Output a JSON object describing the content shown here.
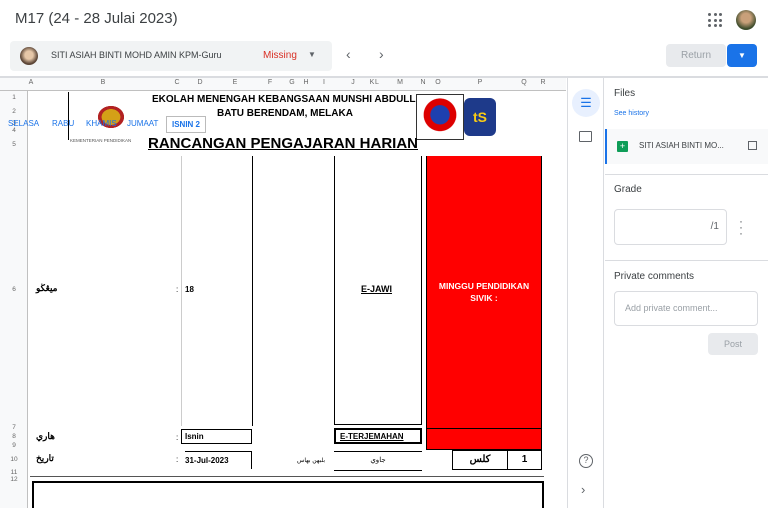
{
  "header": {
    "title": "M17 (24 - 28 Julai 2023)",
    "apps_icon": "apps-grid-icon"
  },
  "student_bar": {
    "name": "SITI ASIAH BINTI MOHD AMIN KPM-Guru",
    "status": "Missing",
    "status_color": "#d93025"
  },
  "actions": {
    "return_label": "Return"
  },
  "sheet": {
    "columns": [
      "A",
      "B",
      "C",
      "D",
      "E",
      "F",
      "G",
      "H",
      "I",
      "J",
      "K",
      "L",
      "M",
      "N",
      "O",
      "P",
      "Q",
      "R"
    ],
    "rows": [
      "1",
      "2",
      "3",
      "4",
      "5",
      "6",
      "7",
      "8",
      "9",
      "10",
      "11",
      "12"
    ],
    "school_name": "EKOLAH MENENGAH KEBANGSAAN MUNSHI ABDULLAH",
    "school_location": "BATU BERENDAM, MELAKA",
    "ministry": "KEMENTERIAN PENDIDIKAN",
    "heading": "RANCANGAN PENGAJARAN HARIAN",
    "sheet_tabs": [
      "SELASA",
      "RABU",
      "KHAMIS",
      "JUMAAT",
      "ISNIN 2"
    ],
    "active_tab": "ISNIN 2",
    "minggu_label": "ميڠڬو",
    "colon": ":",
    "minggu_value": "18",
    "subject": "E-JAWI",
    "red_note": "MINGGU PENDIDIKAN SIVIK :",
    "red_color": "#ff0000",
    "hari_label": "هاري",
    "hari_value": "Isnin",
    "subject2": "E-TERJEMAHAN",
    "tarikh_label": "تاريخ",
    "tarikh_value": "31-Jul-2023",
    "bahasa_label": "بلبهن بهاس",
    "bahasa_value": "جاوي",
    "kelas_label": "كلس",
    "kelas_value": "1"
  },
  "right_panel": {
    "files_title": "Files",
    "see_history": "See history",
    "file_name": "SITI ASIAH BINTI MO...",
    "grade_title": "Grade",
    "grade_max": "/1",
    "comments_title": "Private comments",
    "comment_placeholder": "Add private comment...",
    "post_label": "Post"
  }
}
